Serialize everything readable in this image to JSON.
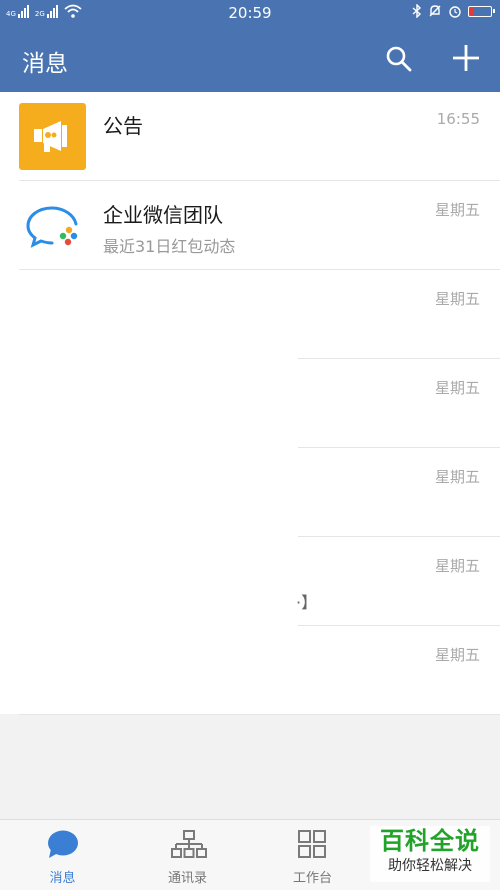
{
  "status_bar": {
    "signal1_label": "4G",
    "signal2_label": "2G",
    "time": "20:59",
    "battery_level": 0.15,
    "icons": [
      "signal-icon",
      "wifi-icon",
      "bluetooth-icon",
      "bell-off-icon",
      "alarm-icon",
      "battery-icon"
    ]
  },
  "header": {
    "title": "消息",
    "search_icon": "search-icon",
    "add_icon": "plus-icon"
  },
  "messages": [
    {
      "name": "公告",
      "preview": "",
      "time": "16:55",
      "avatar": "megaphone-icon"
    },
    {
      "name": "企业微信团队",
      "preview": "最近31日红包动态",
      "time": "星期五",
      "avatar": "wecom-logo-icon"
    },
    {
      "name": "",
      "preview": "",
      "time": "星期五"
    },
    {
      "name": "",
      "preview": "",
      "time": "星期五"
    },
    {
      "name": "",
      "preview": "",
      "time": "星期五"
    },
    {
      "name": "",
      "preview": "",
      "time": "星期五",
      "mark": "·】"
    },
    {
      "name": "",
      "preview": "",
      "time": "星期五"
    }
  ],
  "tabs": [
    {
      "label": "消息",
      "icon": "chat-bubble-icon",
      "active": true
    },
    {
      "label": "通讯录",
      "icon": "org-chart-icon",
      "active": false
    },
    {
      "label": "工作台",
      "icon": "grid-icon",
      "active": false
    }
  ],
  "watermark": {
    "line1": "百科全说",
    "line2": "助你轻松解决"
  },
  "colors": {
    "header_bg": "#4a74b1",
    "accent": "#3b7fd4",
    "announcement_bg": "#f5ad1e",
    "watermark_green": "#21a32a"
  }
}
